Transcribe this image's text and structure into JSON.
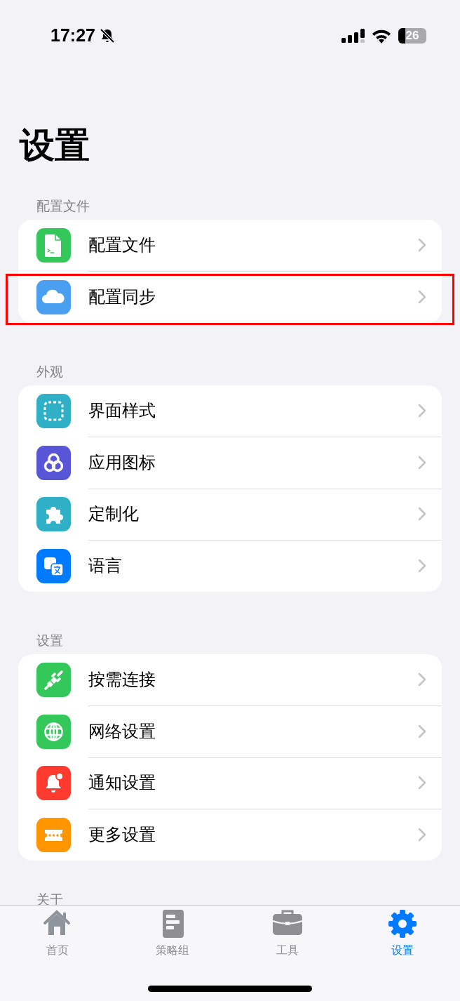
{
  "status_bar": {
    "time": "17:27",
    "battery": "26"
  },
  "title": "设置",
  "sections": [
    {
      "header": "配置文件",
      "items": [
        {
          "label": "配置文件",
          "kind": "file",
          "color": "#34c759",
          "highlighted": false
        },
        {
          "label": "配置同步",
          "kind": "cloud",
          "color": "#4a9ff0",
          "highlighted": true
        }
      ]
    },
    {
      "header": "外观",
      "items": [
        {
          "label": "界面样式",
          "kind": "frame",
          "color": "#30b0c7",
          "highlighted": false
        },
        {
          "label": "应用图标",
          "kind": "trefoil",
          "color": "#5856d6",
          "highlighted": false
        },
        {
          "label": "定制化",
          "kind": "puzzle",
          "color": "#30b0c7",
          "highlighted": false
        },
        {
          "label": "语言",
          "kind": "translate",
          "color": "#007aff",
          "highlighted": false
        }
      ]
    },
    {
      "header": "设置",
      "items": [
        {
          "label": "按需连接",
          "kind": "plug",
          "color": "#34c759",
          "highlighted": false
        },
        {
          "label": "网络设置",
          "kind": "globe",
          "color": "#34c759",
          "highlighted": false
        },
        {
          "label": "通知设置",
          "kind": "bell",
          "color": "#ff3b30",
          "highlighted": false
        },
        {
          "label": "更多设置",
          "kind": "ticket",
          "color": "#ff9500",
          "highlighted": false
        }
      ]
    },
    {
      "header": "关于"
    }
  ],
  "tabs": [
    {
      "label": "首页",
      "kind": "home",
      "selected": false
    },
    {
      "label": "策略组",
      "kind": "list",
      "selected": false
    },
    {
      "label": "工具",
      "kind": "briefcase",
      "selected": false
    },
    {
      "label": "设置",
      "kind": "gear",
      "selected": true
    }
  ]
}
